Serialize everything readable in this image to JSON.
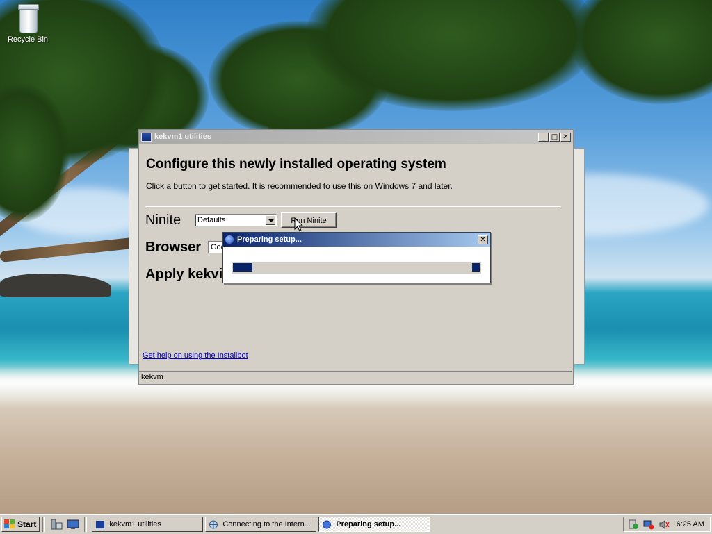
{
  "desktop": {
    "icons": [
      {
        "label": "Recycle Bin",
        "icon": "recycle-bin-icon"
      }
    ]
  },
  "window": {
    "title": "kekvm1 utilities",
    "heading": "Configure this newly installed operating system",
    "subtext": "Click a button to get started. It is recommended to use this on Windows 7 and later.",
    "ninite": {
      "label": "Ninite",
      "selected": "Defaults",
      "button": "Run Ninite"
    },
    "browser": {
      "label": "Browser",
      "selected": "Goo"
    },
    "apply": {
      "label": "Apply kekvi"
    },
    "help_link": "Get help on using the Installbot",
    "status": "kekvm"
  },
  "dialog": {
    "title": "Preparing setup...",
    "progress_indeterminate": true
  },
  "taskbar": {
    "start_label": "Start",
    "quick_launch": [
      "server-manager-icon",
      "show-desktop-icon"
    ],
    "tasks": [
      {
        "label": "kekvm1 utilities",
        "icon": "app-window-icon",
        "active": false
      },
      {
        "label": "Connecting to the Intern...",
        "icon": "globe-icon",
        "active": false
      },
      {
        "label": "Preparing setup...",
        "icon": "installer-icon",
        "active": true
      }
    ],
    "clock": "6:25 AM"
  },
  "colors": {
    "title_active_start": "#0a246a",
    "title_active_end": "#a6caf0",
    "progress_fill": "#0a246a",
    "link": "#0000c8"
  }
}
